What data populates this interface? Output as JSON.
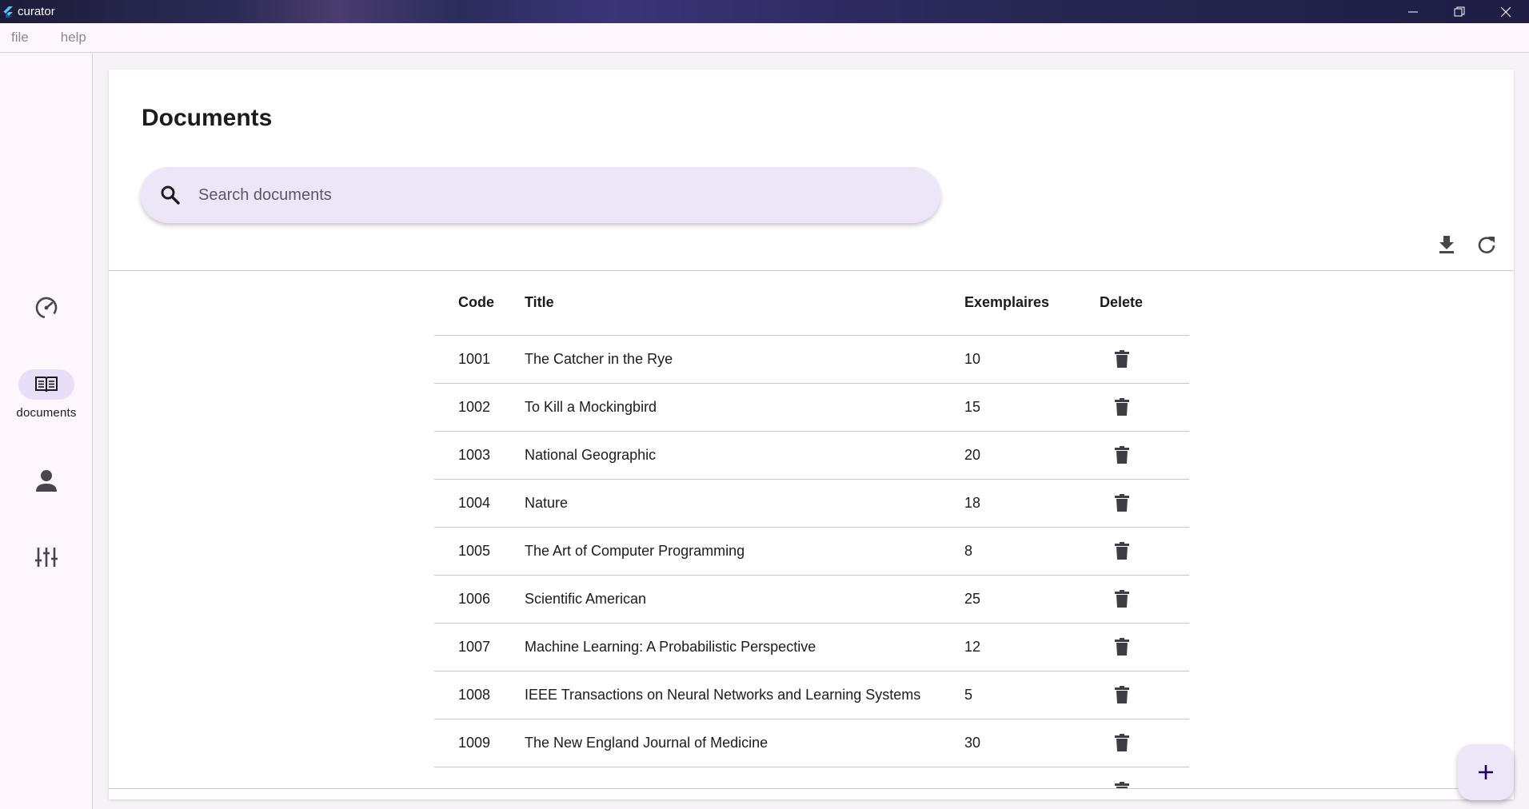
{
  "window": {
    "title": "curator"
  },
  "menu": {
    "items": [
      "file",
      "help"
    ]
  },
  "rail": {
    "items": [
      {
        "icon": "speedometer-icon",
        "label": ""
      },
      {
        "icon": "book-icon",
        "label": "documents",
        "active": true
      },
      {
        "icon": "person-icon",
        "label": ""
      },
      {
        "icon": "sliders-icon",
        "label": ""
      }
    ]
  },
  "page": {
    "title": "Documents",
    "search_placeholder": "Search documents"
  },
  "table": {
    "headers": {
      "code": "Code",
      "title": "Title",
      "exemplaires": "Exemplaires",
      "delete": "Delete"
    },
    "rows": [
      {
        "code": "1001",
        "title": "The Catcher in the Rye",
        "exemplaires": "10"
      },
      {
        "code": "1002",
        "title": "To Kill a Mockingbird",
        "exemplaires": "15"
      },
      {
        "code": "1003",
        "title": "National Geographic",
        "exemplaires": "20"
      },
      {
        "code": "1004",
        "title": "Nature",
        "exemplaires": "18"
      },
      {
        "code": "1005",
        "title": "The Art of Computer Programming",
        "exemplaires": "8"
      },
      {
        "code": "1006",
        "title": "Scientific American",
        "exemplaires": "25"
      },
      {
        "code": "1007",
        "title": "Machine Learning: A Probabilistic Perspective",
        "exemplaires": "12"
      },
      {
        "code": "1008",
        "title": "IEEE Transactions on Neural Networks and Learning Systems",
        "exemplaires": "5"
      },
      {
        "code": "1009",
        "title": "The New England Journal of Medicine",
        "exemplaires": "30"
      },
      {
        "code": "",
        "title": "",
        "exemplaires": ""
      }
    ]
  },
  "colors": {
    "accent": "#ece6f8",
    "rail_active": "#e7dff8",
    "icon": "#49454f"
  }
}
